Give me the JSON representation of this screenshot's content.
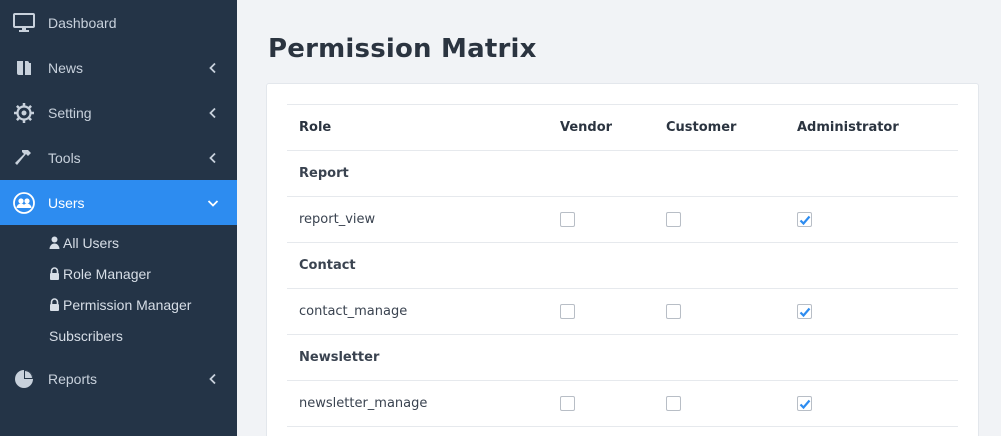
{
  "sidebar": {
    "items": [
      {
        "label": "Dashboard",
        "icon": "monitor-icon"
      },
      {
        "label": "News",
        "icon": "book-icon"
      },
      {
        "label": "Setting",
        "icon": "gear-icon"
      },
      {
        "label": "Tools",
        "icon": "hammer-icon"
      },
      {
        "label": "Users",
        "icon": "users-icon",
        "active": true
      },
      {
        "label": "Reports",
        "icon": "pie-chart-icon"
      }
    ],
    "users_submenu": [
      {
        "label": "All Users",
        "icon": "user-icon"
      },
      {
        "label": "Role Manager",
        "icon": "lock-icon"
      },
      {
        "label": "Permission Manager",
        "icon": "lock-icon"
      },
      {
        "label": "Subscribers"
      }
    ],
    "active_color": "#2d8cf0",
    "background_color": "#243447"
  },
  "main": {
    "title": "Permission Matrix",
    "table": {
      "headers": [
        "Role",
        "Vendor",
        "Customer",
        "Administrator"
      ],
      "groups": [
        {
          "name": "Report",
          "permissions": [
            {
              "name": "report_view",
              "vendor": false,
              "customer": false,
              "administrator": true
            }
          ]
        },
        {
          "name": "Contact",
          "permissions": [
            {
              "name": "contact_manage",
              "vendor": false,
              "customer": false,
              "administrator": true
            }
          ]
        },
        {
          "name": "Newsletter",
          "permissions": [
            {
              "name": "newsletter_manage",
              "vendor": false,
              "customer": false,
              "administrator": true
            }
          ]
        }
      ]
    },
    "check_color": "#2d8cf0"
  }
}
